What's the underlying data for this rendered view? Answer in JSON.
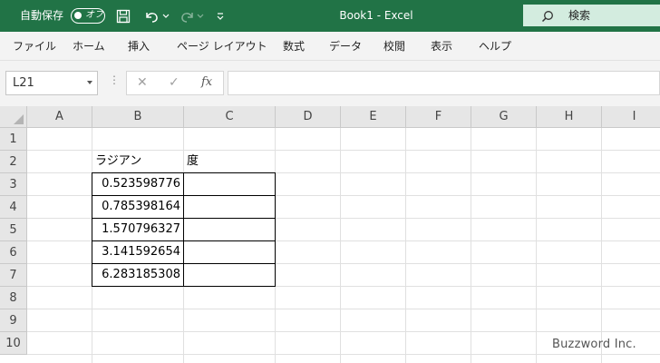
{
  "titlebar": {
    "autosave_label": "自動保存",
    "autosave_toggle": "オフ",
    "title": "Book1  -  Excel",
    "search_placeholder": "検索"
  },
  "menu": [
    "ファイル",
    "ホーム",
    "挿入",
    "ページ レイアウト",
    "数式",
    "データ",
    "校閲",
    "表示",
    "ヘルプ"
  ],
  "formula_bar": {
    "name_box": "L21",
    "cancel": "✕",
    "enter": "✓",
    "fx": "fx",
    "value": ""
  },
  "sheet": {
    "columns": [
      "A",
      "B",
      "C",
      "D",
      "E",
      "F",
      "G",
      "H",
      "I"
    ],
    "rows": [
      "1",
      "2",
      "3",
      "4",
      "5",
      "6",
      "7",
      "8",
      "9",
      "10"
    ],
    "header_b2": "ラジアン",
    "header_c2": "度",
    "radians": [
      "0.523598776",
      "0.785398164",
      "1.570796327",
      "3.141592654",
      "6.283185308"
    ],
    "degrees": [
      "",
      "",
      "",
      "",
      ""
    ]
  },
  "watermark": "Buzzword Inc."
}
